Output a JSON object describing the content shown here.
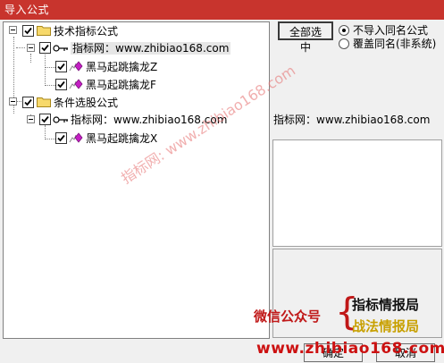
{
  "window": {
    "title": "导入公式"
  },
  "tree": {
    "groups": [
      {
        "label": "技术指标公式",
        "checked": true,
        "source": {
          "label": "指标网：www.zhibiao168.com"
        },
        "items": [
          {
            "label": "黑马起跳擒龙Z",
            "checked": true
          },
          {
            "label": "黑马起跳擒龙F",
            "checked": true
          }
        ]
      },
      {
        "label": "条件选股公式",
        "checked": true,
        "source": {
          "label": "指标网：www.zhibiao168.com"
        },
        "items": [
          {
            "label": "黑马起跳擒龙X",
            "checked": true
          }
        ]
      }
    ]
  },
  "options": {
    "select_all_label": "全部选中",
    "radio_no_import_label": "不导入同名公式",
    "radio_overwrite_label": "覆盖同名(非系统)",
    "selected": "no_import"
  },
  "info": {
    "source_text": "指标网：www.zhibiao168.com"
  },
  "footer": {
    "ok_label": "确定",
    "cancel_label": "取消"
  },
  "watermarks": {
    "diagonal": "指标网: www.zhibiao168.com",
    "wechat": "微信公众号",
    "promo_line1": "指标情报局",
    "promo_line2": "战法情报局",
    "site": "www.zhibiao168.com"
  },
  "colors": {
    "titlebar": "#c8342d",
    "watermark_red": "#c01818",
    "promo_gold": "#c8a000"
  }
}
